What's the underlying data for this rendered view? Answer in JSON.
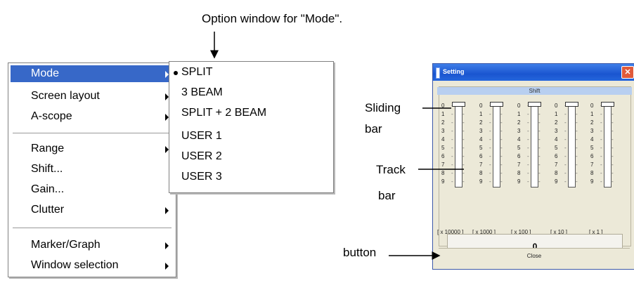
{
  "captions": {
    "option_window": "Option window for \"Mode\".",
    "sliding": "Sliding",
    "bar1": "bar",
    "track": "Track",
    "bar2": "bar",
    "button": "button"
  },
  "menu": {
    "items": [
      {
        "label": "Mode",
        "submenu": true,
        "highlighted": true
      },
      {
        "label": "Screen layout",
        "submenu": true
      },
      {
        "label": "A-scope",
        "submenu": true
      },
      {
        "label": "Range",
        "submenu": true
      },
      {
        "label": "Shift...",
        "submenu": false
      },
      {
        "label": "Gain...",
        "submenu": false
      },
      {
        "label": "Clutter",
        "submenu": true
      },
      {
        "label": "Marker/Graph",
        "submenu": true
      },
      {
        "label": "Window selection",
        "submenu": true
      }
    ]
  },
  "submenu": {
    "items": [
      {
        "label": "SPLIT",
        "selected": true
      },
      {
        "label": "3 BEAM"
      },
      {
        "label": "SPLIT + 2 BEAM"
      },
      {
        "label": "USER 1"
      },
      {
        "label": "USER 2"
      },
      {
        "label": "USER 3"
      }
    ]
  },
  "settings": {
    "title": "Setting",
    "close_glyph": "✕",
    "header": "Shift",
    "digits": [
      "0",
      "1",
      "2",
      "3",
      "4",
      "5",
      "6",
      "7",
      "8",
      "9"
    ],
    "multipliers": [
      "[ x 10000 ]",
      "[ x 1000 ]",
      "[ x 100 ]",
      "[ x 10 ]",
      "[ x 1 ]"
    ],
    "value": "0",
    "close_label": "Close",
    "colors": {
      "titlebar": "#1a55d0",
      "highlight": "#3768c8"
    }
  }
}
